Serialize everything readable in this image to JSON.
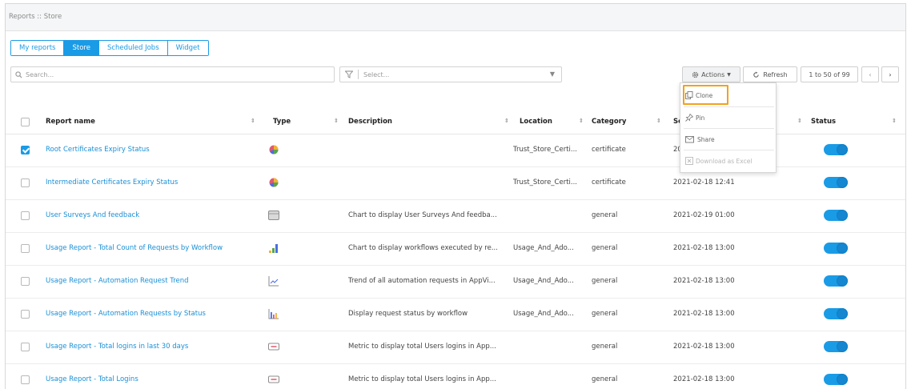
{
  "breadcrumb": "Reports :: Store",
  "tabs": [
    {
      "label": "My reports",
      "active": false
    },
    {
      "label": "Store",
      "active": true
    },
    {
      "label": "Scheduled Jobs",
      "active": false
    },
    {
      "label": "Widget",
      "active": false
    }
  ],
  "search": {
    "placeholder": "Search..."
  },
  "filter": {
    "placeholder": "Select..."
  },
  "toolbar": {
    "actions_label": "Actions",
    "refresh_label": "Refresh",
    "pagination": "1 to 50 of 99"
  },
  "actions_menu": {
    "items": [
      {
        "label": "Clone",
        "icon": "clone-icon",
        "highlighted": true
      },
      {
        "label": "Pin",
        "icon": "pin-icon"
      },
      {
        "label": "Share",
        "icon": "share-icon"
      },
      {
        "label": "Download as Excel",
        "icon": "excel-icon",
        "disabled": true
      }
    ]
  },
  "table": {
    "headers": {
      "name": "Report name",
      "type": "Type",
      "description": "Description",
      "location": "Location",
      "category": "Category",
      "schedule": "Sc",
      "status": "Status"
    },
    "rows": [
      {
        "name": "Root Certificates Expiry Status",
        "type_icon": "pie-chart-icon",
        "description": "",
        "location": "Trust_Store_Certi...",
        "category": "certificate",
        "date": "20",
        "checked": true,
        "status": "on"
      },
      {
        "name": "Intermediate Certificates Expiry Status",
        "type_icon": "pie-chart-icon",
        "description": "",
        "location": "Trust_Store_Certi...",
        "category": "certificate",
        "date": "2021-02-18 12:41",
        "checked": false,
        "status": "on"
      },
      {
        "name": "User Surveys And feedback",
        "type_icon": "table-icon",
        "description": "Chart to display User Surveys And feedba...",
        "location": "",
        "category": "general",
        "date": "2021-02-19 01:00",
        "checked": false,
        "status": "on"
      },
      {
        "name": "Usage Report - Total Count of Requests by Workflow",
        "type_icon": "bar-chart-icon",
        "description": "Chart to display workflows executed by re...",
        "location": "Usage_And_Ado...",
        "category": "general",
        "date": "2021-02-18 13:00",
        "checked": false,
        "status": "on"
      },
      {
        "name": "Usage Report - Automation Request Trend",
        "type_icon": "line-chart-icon",
        "description": "Trend of all automation requests in AppVi...",
        "location": "Usage_And_Ado...",
        "category": "general",
        "date": "2021-02-18 13:00",
        "checked": false,
        "status": "on"
      },
      {
        "name": "Usage Report - Automation Requests by Status",
        "type_icon": "column-chart-icon",
        "description": "Display request status by workflow",
        "location": "Usage_And_Ado...",
        "category": "general",
        "date": "2021-02-18 13:00",
        "checked": false,
        "status": "on"
      },
      {
        "name": "Usage Report - Total logins in last 30 days",
        "type_icon": "metric-icon",
        "description": "Metric to display total Users logins in App...",
        "location": "",
        "category": "general",
        "date": "2021-02-18 13:00",
        "checked": false,
        "status": "on"
      },
      {
        "name": "Usage Report - Total Logins",
        "type_icon": "metric-icon",
        "description": "Metric to display total Users logins in App...",
        "location": "",
        "category": "general",
        "date": "2021-02-18 13:00",
        "checked": false,
        "status": "on"
      }
    ]
  },
  "colors": {
    "accent": "#1a9be6",
    "highlight": "#f1a21c",
    "link": "#1a8fd6"
  }
}
